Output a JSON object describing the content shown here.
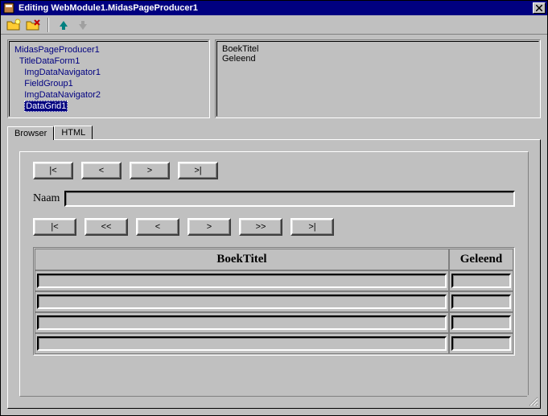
{
  "window": {
    "title": "Editing WebModule1.MidasPageProducer1"
  },
  "toolbar": {
    "icons": [
      "folder-new-icon",
      "folder-delete-icon",
      "arrow-up-icon",
      "arrow-down-icon"
    ]
  },
  "tree": {
    "root": "MidasPageProducer1",
    "items": [
      {
        "label": "TitleDataForm1",
        "indent": 1
      },
      {
        "label": "ImgDataNavigator1",
        "indent": 2
      },
      {
        "label": "FieldGroup1",
        "indent": 2
      },
      {
        "label": "ImgDataNavigator2",
        "indent": 2
      },
      {
        "label": "DataGrid1",
        "indent": 2,
        "selected": true
      }
    ]
  },
  "props": {
    "line1": "BoekTitel",
    "line2": "Geleend"
  },
  "tabs": {
    "browser": "Browser",
    "html": "HTML"
  },
  "preview": {
    "nav1": {
      "first": "|<",
      "prev": "<",
      "next": ">",
      "last": ">|"
    },
    "field": {
      "label": "Naam",
      "value": ""
    },
    "nav2": {
      "first": "|<",
      "prevpage": "<<",
      "prev": "<",
      "next": ">",
      "nextpage": ">>",
      "last": ">|"
    },
    "grid": {
      "headers": {
        "titel": "BoekTitel",
        "geleend": "Geleend"
      },
      "rows": [
        {
          "titel": "",
          "geleend": ""
        },
        {
          "titel": "",
          "geleend": ""
        },
        {
          "titel": "",
          "geleend": ""
        },
        {
          "titel": "",
          "geleend": ""
        }
      ]
    }
  }
}
